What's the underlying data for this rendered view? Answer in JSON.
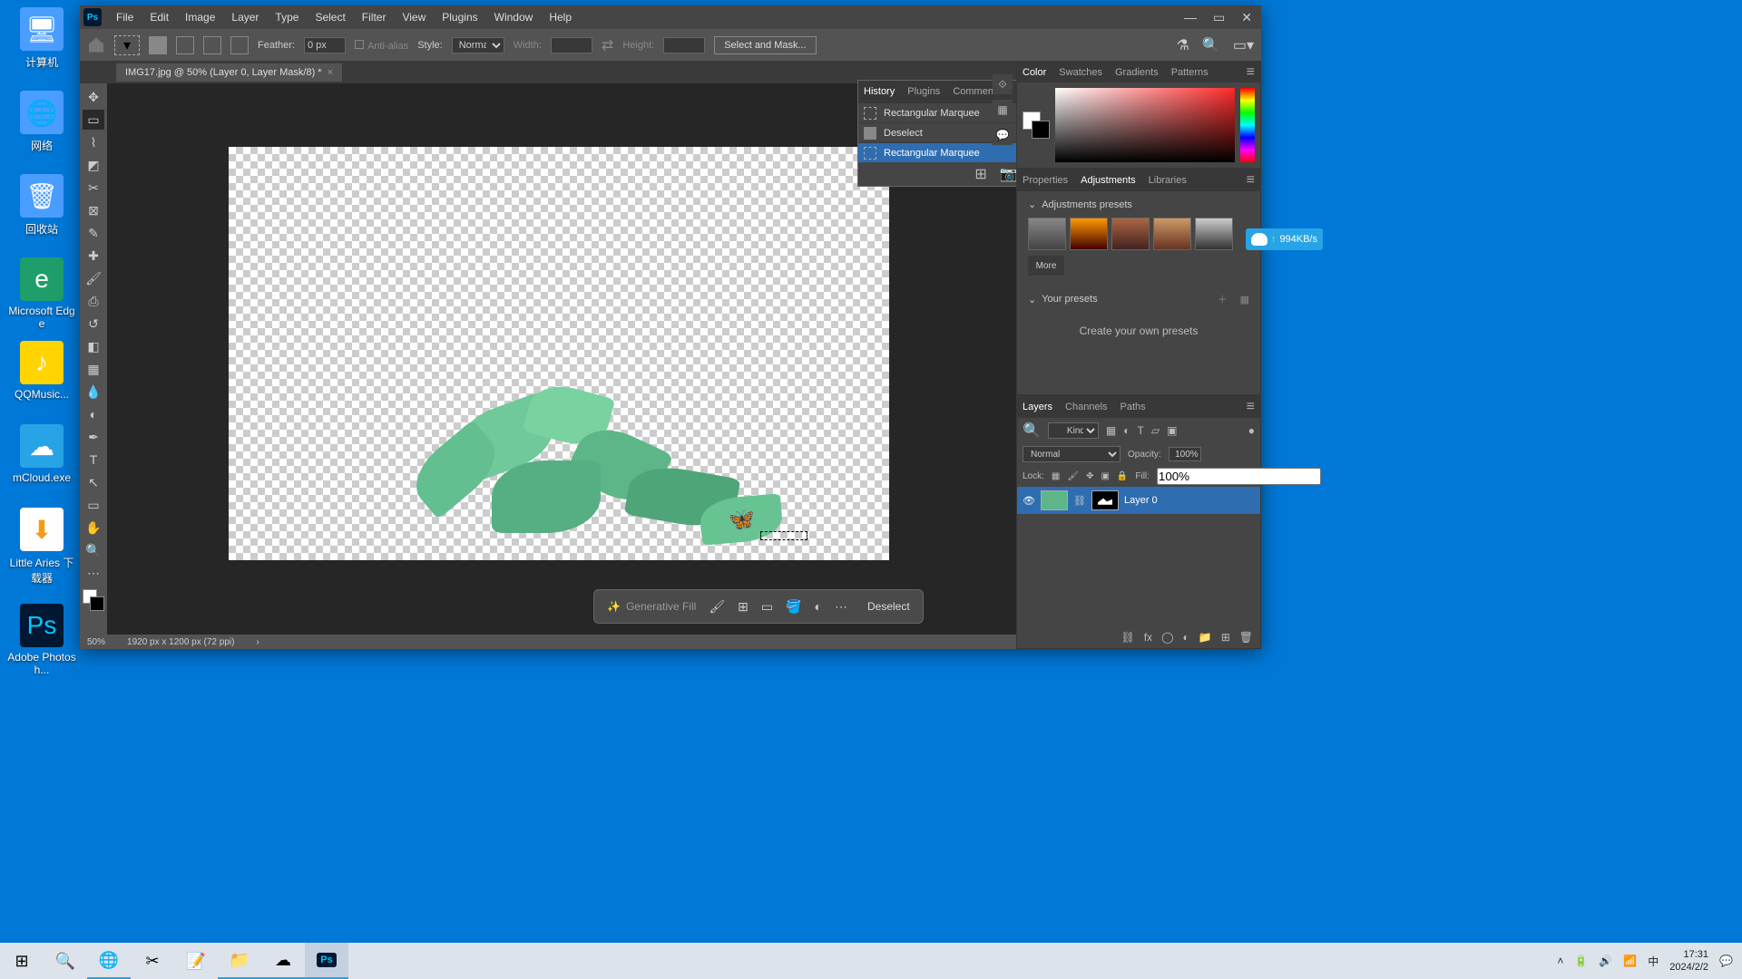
{
  "desktop": {
    "icons": [
      {
        "label": "计算机",
        "glyph": "🖥"
      },
      {
        "label": "网络",
        "glyph": "🌐"
      },
      {
        "label": "回收站",
        "glyph": "🗑"
      },
      {
        "label": "Microsoft Edge",
        "glyph": "e"
      },
      {
        "label": "QQMusic...",
        "glyph": "♪"
      },
      {
        "label": "mCloud.exe",
        "glyph": "☁"
      },
      {
        "label": "Little Aries 下载器",
        "glyph": "⬇"
      },
      {
        "label": "Adobe Photosh...",
        "glyph": "Ps"
      }
    ]
  },
  "menubar": [
    "File",
    "Edit",
    "Image",
    "Layer",
    "Type",
    "Select",
    "Filter",
    "View",
    "Plugins",
    "Window",
    "Help"
  ],
  "options": {
    "feather_label": "Feather:",
    "feather_value": "0 px",
    "antialias_label": "Anti-alias",
    "style_label": "Style:",
    "style_value": "Normal",
    "width_label": "Width:",
    "height_label": "Height:",
    "mask_btn": "Select and Mask..."
  },
  "doc": {
    "tab": "IMG17.jpg @ 50% (Layer 0, Layer Mask/8) *"
  },
  "history": {
    "tabs": [
      "History",
      "Plugins",
      "Comments"
    ],
    "items": [
      "Rectangular Marquee",
      "Deselect",
      "Rectangular Marquee"
    ]
  },
  "ctxbar": {
    "genfill": "Generative Fill",
    "deselect": "Deselect"
  },
  "status": {
    "zoom": "50%",
    "info": "1920 px x 1200 px (72 ppi)"
  },
  "panels": {
    "color": {
      "tabs": [
        "Color",
        "Swatches",
        "Gradients",
        "Patterns"
      ]
    },
    "adjust": {
      "tabs": [
        "Properties",
        "Adjustments",
        "Libraries"
      ],
      "sec1": "Adjustments presets",
      "more": "More",
      "sec2": "Your presets",
      "create": "Create your own presets"
    },
    "layers": {
      "tabs": [
        "Layers",
        "Channels",
        "Paths"
      ],
      "kind": "Kind",
      "blend": "Normal",
      "opacity_label": "Opacity:",
      "opacity": "100%",
      "lock_label": "Lock:",
      "fill_label": "Fill:",
      "fill": "100%",
      "layer0": "Layer 0"
    }
  },
  "badge": {
    "speed": "994KB/s"
  },
  "clock": {
    "time": "17:31",
    "date": "2024/2/2",
    "ime": "中"
  }
}
